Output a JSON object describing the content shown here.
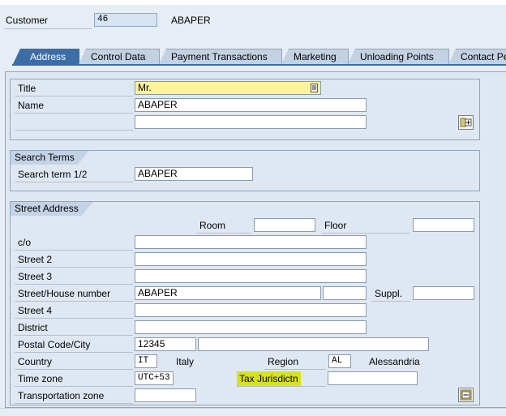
{
  "header": {
    "customer_label": "Customer",
    "customer_value": "46",
    "customer_name": "ABAPER"
  },
  "tabs": [
    {
      "label": "Address"
    },
    {
      "label": "Control Data"
    },
    {
      "label": "Payment Transactions"
    },
    {
      "label": "Marketing"
    },
    {
      "label": "Unloading Points"
    },
    {
      "label": "Contact Pe"
    }
  ],
  "name_section": {
    "title_label": "Title",
    "title_value": "Mr.",
    "name_label": "Name",
    "name_value": "ABAPER",
    "name2_value": ""
  },
  "search_terms": {
    "header": "Search Terms",
    "label": "Search term 1/2",
    "value": "ABAPER"
  },
  "street_address": {
    "header": "Street Address",
    "room_label": "Room",
    "room_value": "",
    "floor_label": "Floor",
    "floor_value": "",
    "co_label": "c/o",
    "co_value": "",
    "street2_label": "Street 2",
    "street2_value": "",
    "street3_label": "Street 3",
    "street3_value": "",
    "street_label": "Street/House number",
    "street_value": "ABAPER",
    "house_value": "",
    "suppl_label": "Suppl.",
    "suppl_value": "",
    "street4_label": "Street 4",
    "street4_value": "",
    "district_label": "District",
    "district_value": "",
    "postal_label": "Postal Code/City",
    "postal_value": "12345",
    "city_value": "",
    "country_label": "Country",
    "country_value": "IT",
    "country_name": "Italy",
    "region_label": "Region",
    "region_value": "AL",
    "region_name": "Alessandria",
    "timezone_label": "Time zone",
    "timezone_value": "UTC+53",
    "tax_label": "Tax Jurisdictn",
    "tax_value": "",
    "transport_label": "Transportation zone",
    "transport_value": ""
  },
  "colors": {
    "active_tab": "#3c6ea5",
    "required_field": "#fff29b",
    "tax_highlight": "#d8e21c"
  }
}
